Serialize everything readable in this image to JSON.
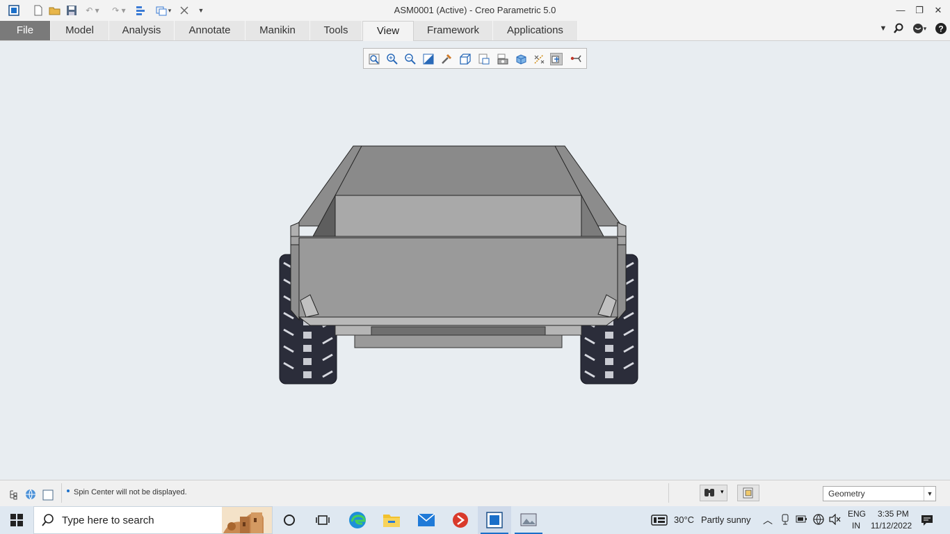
{
  "window": {
    "title": "ASM0001 (Active) - Creo Parametric 5.0",
    "min_glyph": "—",
    "restore_glyph": "❐",
    "close_glyph": "✕"
  },
  "ribbon": {
    "tabs": [
      {
        "label": "File"
      },
      {
        "label": "Model"
      },
      {
        "label": "Analysis"
      },
      {
        "label": "Annotate"
      },
      {
        "label": "Manikin"
      },
      {
        "label": "Tools"
      },
      {
        "label": "View"
      },
      {
        "label": "Framework"
      },
      {
        "label": "Applications"
      }
    ],
    "active_tab": "View"
  },
  "status": {
    "message": "Spin Center will not be displayed.",
    "filter": "Geometry"
  },
  "taskbar": {
    "search_placeholder": "Type here to search",
    "weather_temp": "30°C",
    "weather_desc": "Partly sunny",
    "lang_top": "ENG",
    "lang_bottom": "IN",
    "time": "3:35 PM",
    "date": "11/12/2022"
  },
  "colors": {
    "accent": "#1a6fc9",
    "file_tab": "#7a7a7a",
    "viewport_bg": "#e8edf1"
  }
}
